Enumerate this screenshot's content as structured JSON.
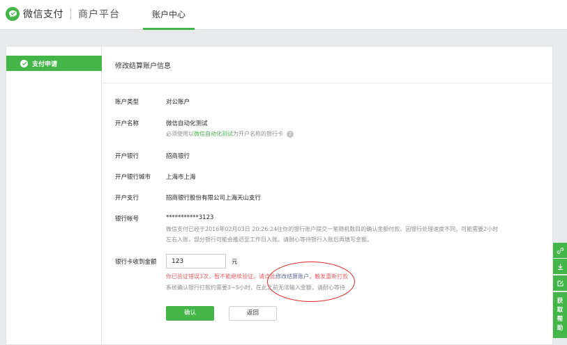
{
  "header": {
    "brand": "微信支付",
    "platform": "商户平台",
    "tab": "账户中心"
  },
  "sidebar": {
    "items": [
      {
        "label": "支付申请",
        "icon": "wechat-pay-icon",
        "active": true
      }
    ]
  },
  "page": {
    "title": "修改结算账户信息"
  },
  "fields": {
    "account_type_label": "账户类型",
    "account_type_value": "对公账户",
    "account_name_label": "开户名称",
    "account_name_value": "微信自动化测试",
    "account_name_hint_prefix": "必须使用以",
    "account_name_hint_name": "微信自动化测试",
    "account_name_hint_suffix": "为开户名称的银行卡",
    "bank_label": "开户银行",
    "bank_value": "招商银行",
    "city_label": "开户银行城市",
    "city_value": "上海市上海",
    "branch_label": "开户支行",
    "branch_value": "招商银行股份有限公司上海天山支行",
    "account_no_label": "银行帐号",
    "account_no_value": "***********3123",
    "account_no_desc_line1": "微信支付已经于2016年02月03日 20:26:24往你的银行账户提交一笔随机数目的确认金额付款。因银行处理速度不同，可能需要2小时",
    "account_no_desc_line2": "左右入账，部分银行可能会推迟至工作日入账。请耐心等待银行入账后再填写金额。"
  },
  "amount": {
    "label": "银行卡收到金额",
    "value": "123",
    "unit": "元",
    "error_prefix": "你已验证错误3次，暂不能继续验证。请点此",
    "error_link": "修改结算账户",
    "error_suffix": "，触发重新打款",
    "note": "系统确认银行打款约需要3~5小时，在此之前无法输入金额，请耐心等待"
  },
  "buttons": {
    "confirm": "确认",
    "back": "返回"
  },
  "toolbar": {
    "help": [
      "获",
      "取",
      "帮",
      "助"
    ]
  },
  "colors": {
    "accent": "#44b549",
    "error": "#e15f63",
    "link": "#576b95",
    "annotation": "#e02424"
  }
}
